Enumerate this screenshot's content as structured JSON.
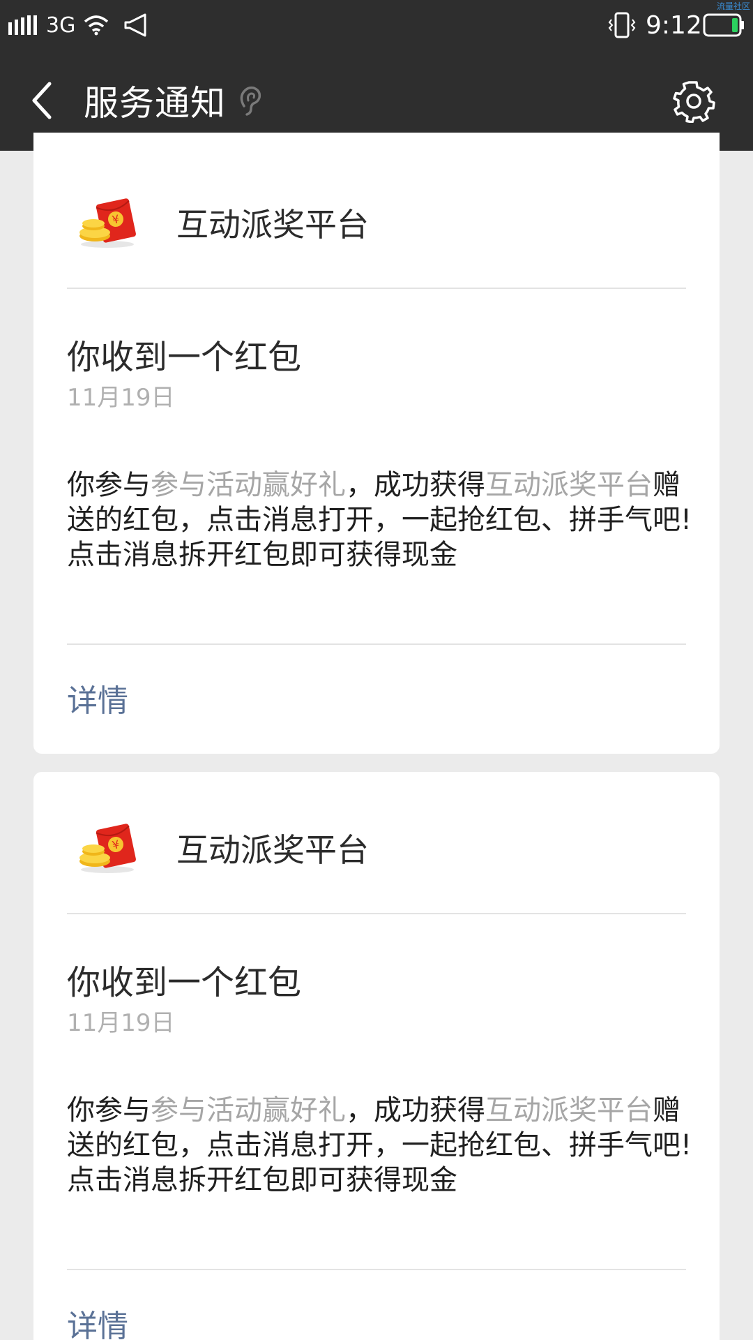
{
  "status_bar": {
    "network": "3G",
    "time": "9:12",
    "watermark": "流量社区",
    "icons": [
      "signal-icon",
      "wifi-icon",
      "speaker-icon",
      "vibrate-icon",
      "battery-icon"
    ]
  },
  "header": {
    "title": "服务通知",
    "icons": [
      "back-icon",
      "ear-icon",
      "settings-icon"
    ]
  },
  "colors": {
    "bar_bg": "#2e2e2e",
    "page_bg": "#ebebeb",
    "link": "#5a7196",
    "muted": "#a6a6a6",
    "red_packet": "#e0261c"
  },
  "cards": [
    {
      "app_name": "互动派奖平台",
      "title": "你收到一个红包",
      "date": "11月19日",
      "body": {
        "p1": "你参与",
        "activity": "参与活动赢好礼",
        "p2": "，成功获得",
        "sender": "互动派奖平台",
        "p3": "赠送的红包，点击消息打开，一起抢红包、拼手气吧!",
        "p4": "点击消息拆开红包即可获得现金"
      },
      "details_label": "详情"
    },
    {
      "app_name": "互动派奖平台",
      "title": "你收到一个红包",
      "date": "11月19日",
      "body": {
        "p1": "你参与",
        "activity": "参与活动赢好礼",
        "p2": "，成功获得",
        "sender": "互动派奖平台",
        "p3": "赠送的红包，点击消息打开，一起抢红包、拼手气吧!",
        "p4": "点击消息拆开红包即可获得现金"
      },
      "details_label": "详情"
    }
  ]
}
